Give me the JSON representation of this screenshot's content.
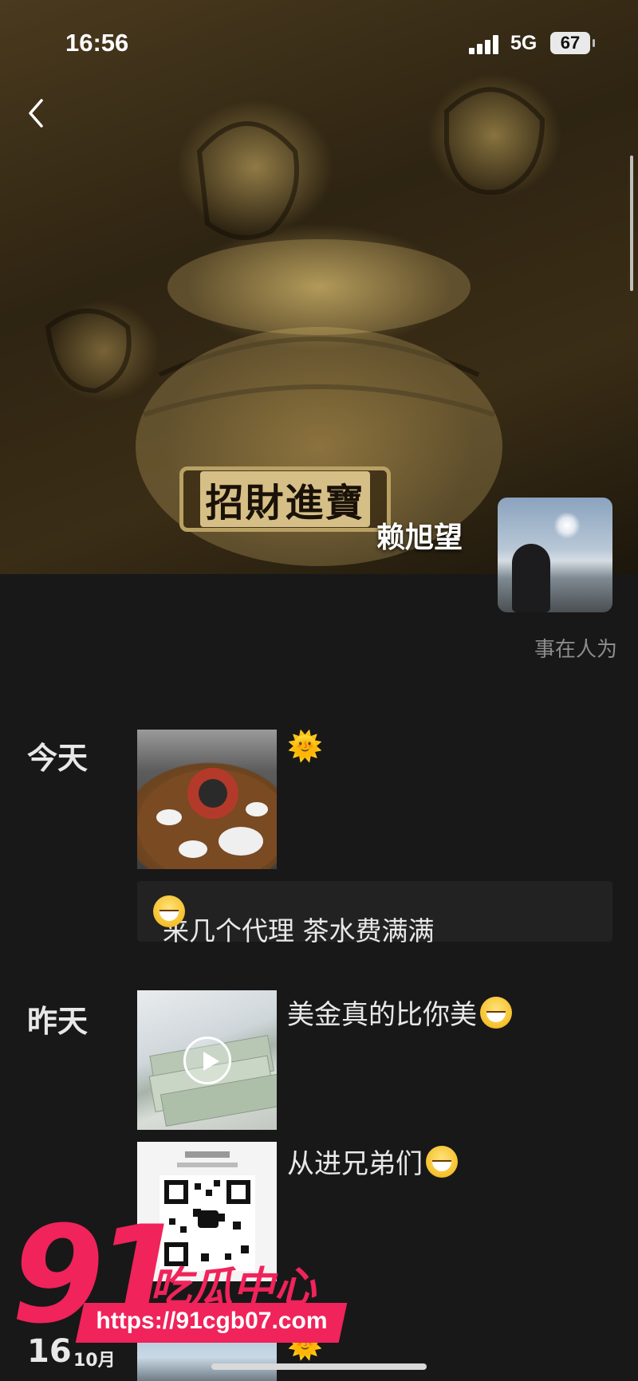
{
  "status_bar": {
    "time": "16:56",
    "network": "5G",
    "battery": "67"
  },
  "cover": {
    "plaque_text": "招財進寶"
  },
  "profile": {
    "name": "赖旭望",
    "signature": "事在人为"
  },
  "moments": [
    {
      "day": "今天",
      "items": [
        {
          "type": "photo",
          "emoji": "🌞"
        },
        {
          "type": "text",
          "text": "来几个代理 茶水费满满"
        }
      ]
    },
    {
      "day": "昨天",
      "items": [
        {
          "type": "video",
          "text": "美金真的比你美"
        },
        {
          "type": "photo",
          "text": "从进兄弟们"
        }
      ]
    },
    {
      "day_number": "16",
      "month": "10月",
      "items": [
        {
          "type": "photo",
          "emoji": "🌞"
        }
      ]
    }
  ],
  "watermark": {
    "number": "91",
    "title": "吃瓜中心",
    "url": "https://91cgb07.com"
  }
}
